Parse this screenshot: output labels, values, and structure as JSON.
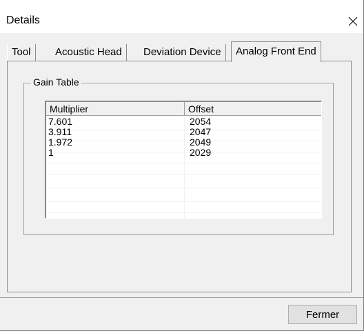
{
  "window": {
    "title": "Details",
    "close_icon": "close-icon"
  },
  "tabs": [
    {
      "label": "Tool",
      "active": false
    },
    {
      "label": "Acoustic Head",
      "active": false
    },
    {
      "label": "Deviation Device",
      "active": false
    },
    {
      "label": "Analog Front End",
      "active": true
    }
  ],
  "gain_table": {
    "group_label": "Gain Table",
    "columns": [
      "Multiplier",
      "Offset"
    ],
    "rows": [
      {
        "multiplier": "7.601",
        "offset": "2054"
      },
      {
        "multiplier": "3.911",
        "offset": "2047"
      },
      {
        "multiplier": "1.972",
        "offset": "2049"
      },
      {
        "multiplier": "1",
        "offset": "2029"
      }
    ]
  },
  "footer": {
    "close_label": "Fermer"
  }
}
